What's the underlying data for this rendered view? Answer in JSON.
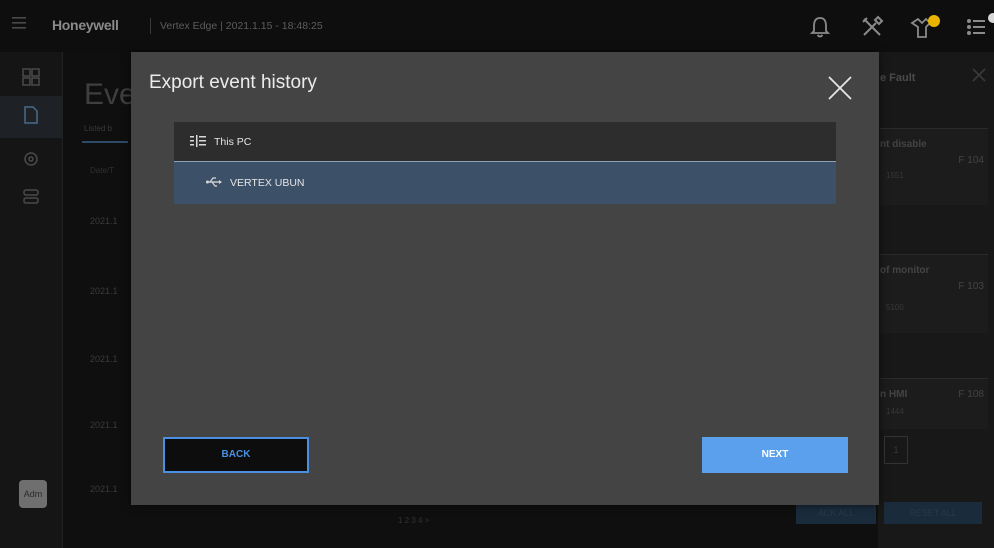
{
  "header": {
    "brand": "Honeywell",
    "subtitle": "Vertex Edge | 2021.1.15 - 18:48:25",
    "notification_count_badge": "",
    "icons": [
      "menu-icon",
      "bell-icon",
      "tools-icon",
      "trouble-icon",
      "event-list-icon"
    ]
  },
  "sidebar": {
    "icons": [
      "dashboard-icon",
      "document-icon",
      "settings-icon",
      "devices-icon"
    ],
    "avatar": "Adm"
  },
  "background_page": {
    "title": "Eve",
    "listed": "Listed b",
    "column_date": "Date/T",
    "row_dates": [
      "2021.1",
      "2021.1",
      "2021.1",
      "2021.1",
      "2021.1"
    ],
    "pager": "1 2 3 4 >"
  },
  "right_panel": {
    "title": "e Fault",
    "cards": [
      {
        "title": "nt disable",
        "code": "F 104",
        "sub": "1551"
      },
      {
        "title": "of monitor",
        "code": "F 103",
        "sub": "5100"
      },
      {
        "title": "n HMI",
        "code": "F 108",
        "sub": "1444"
      }
    ],
    "page_box": "1",
    "ack_all": "ACK ALL",
    "reset_all": "RESET ALL"
  },
  "modal": {
    "title": "Export event history",
    "items": [
      {
        "label": "This PC",
        "icon": "computer-icon",
        "selected": false
      },
      {
        "label": "VERTEX UBUN",
        "icon": "usb-icon",
        "selected": true
      }
    ],
    "back_label": "BACK",
    "next_label": "NEXT"
  },
  "colors": {
    "modal_bg": "#444444",
    "selected_row": "#3c5068",
    "accent": "#5aa0ec"
  }
}
